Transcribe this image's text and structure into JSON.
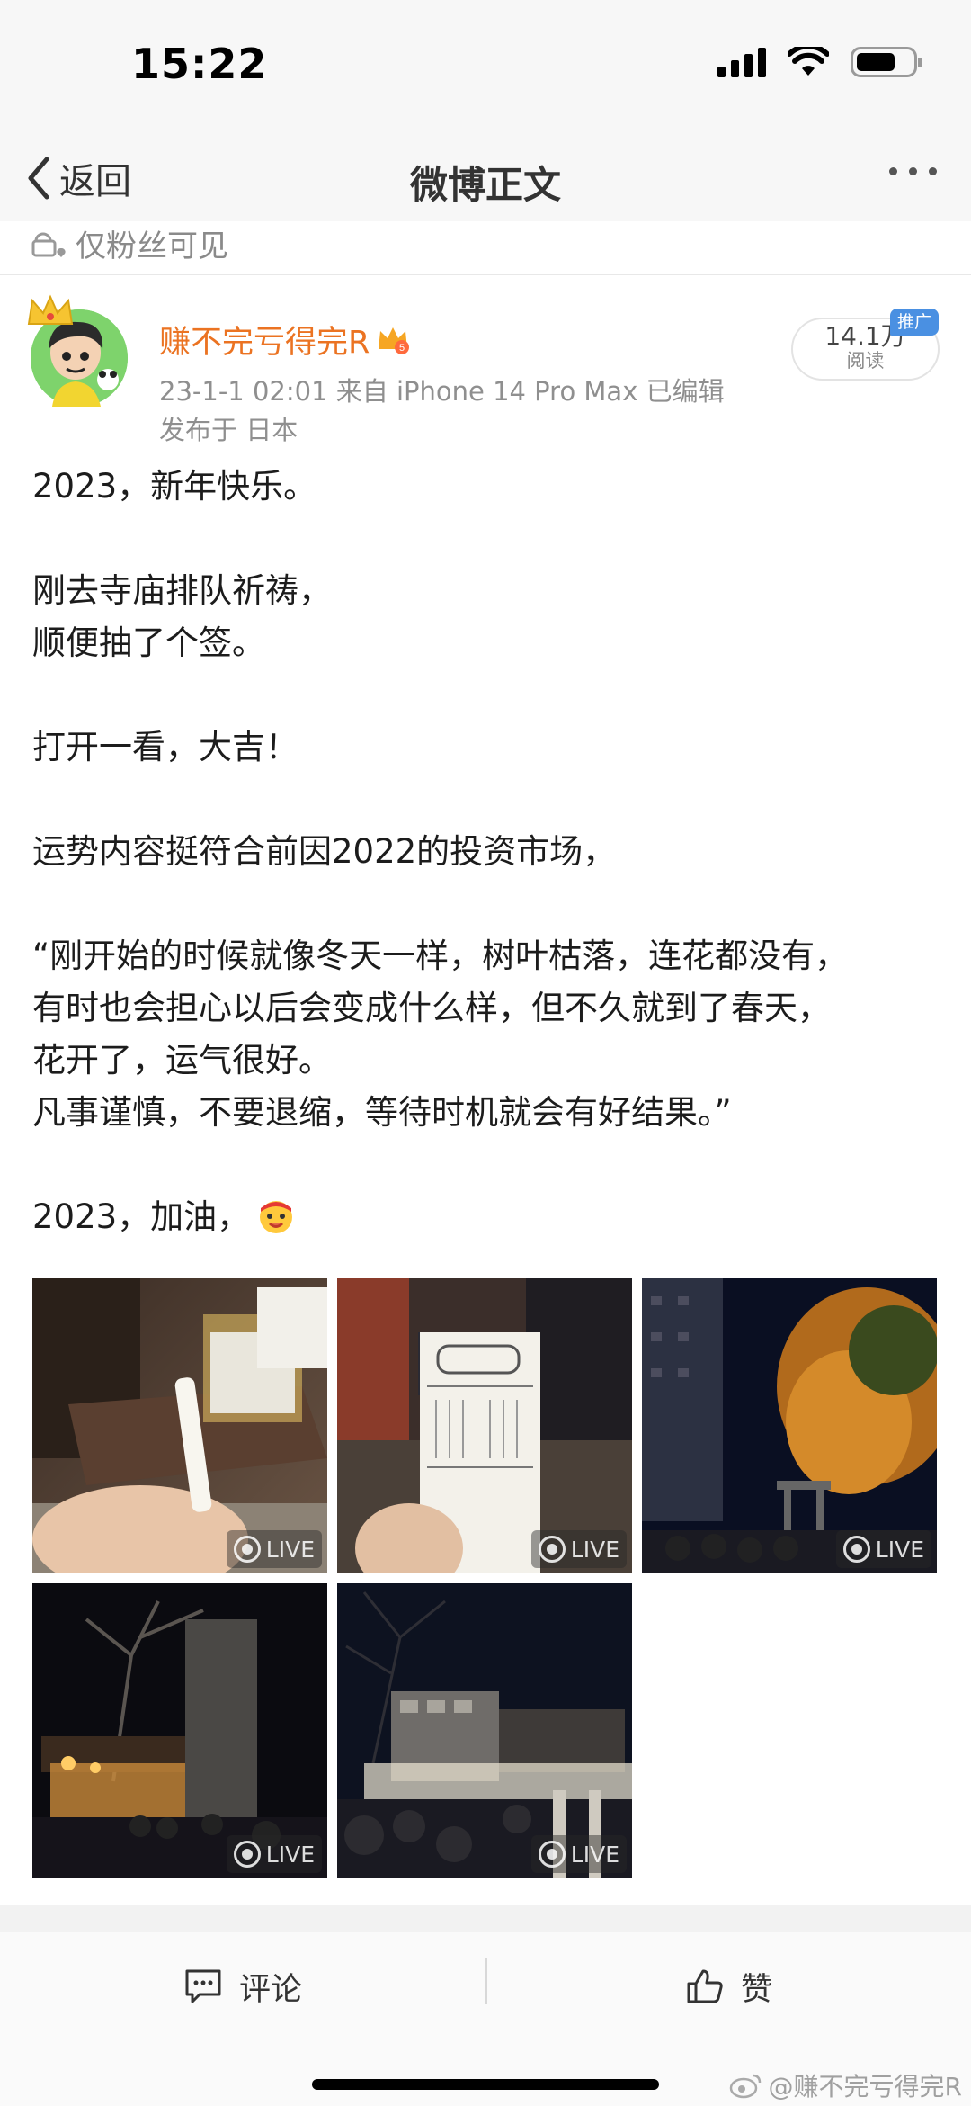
{
  "status_bar": {
    "time": "15:22"
  },
  "nav": {
    "back_label": "返回",
    "title": "微博正文"
  },
  "visibility": {
    "label": "仅粉丝可见"
  },
  "author": {
    "name": "赚不完亏得完R",
    "meta": "23-1-1 02:01  来自 iPhone 14 Pro Max  已编辑",
    "location": "发布于 日本",
    "name_color": "#eb7322"
  },
  "read_count": {
    "value": "14.1万",
    "label": "阅读",
    "tag": "推广"
  },
  "post": {
    "lines": [
      "2023，新年快乐。",
      "",
      "刚去寺庙排队祈祷，",
      "顺便抽了个签。",
      "",
      "打开一看，大吉！",
      "",
      "运势内容挺符合前因2022的投资市场，",
      "",
      "“刚开始的时候就像冬天一样，树叶枯落，连花都没有，",
      "有时也会担心以后会变成什么样，但不久就到了春天，",
      "花开了，运气很好。",
      "凡事谨慎，不要退缩，等待时机就会有好结果。”",
      "",
      "2023，加油，"
    ]
  },
  "photos": [
    {
      "name": "photo-omikuji-box",
      "badge": "LIVE"
    },
    {
      "name": "photo-omikuji-paper",
      "badge": "LIVE"
    },
    {
      "name": "photo-shrine-night-tree",
      "badge": "LIVE"
    },
    {
      "name": "photo-shrine-crowd",
      "badge": "LIVE"
    },
    {
      "name": "photo-street-crowd",
      "badge": "LIVE"
    }
  ],
  "actions": {
    "comment_label": "评论",
    "like_label": "赞"
  },
  "watermark": {
    "text": "@赚不完亏得完R"
  },
  "colors": {
    "accent": "#eb7322",
    "promo": "#4a90e2",
    "bar_bg": "#f7f7f7"
  }
}
